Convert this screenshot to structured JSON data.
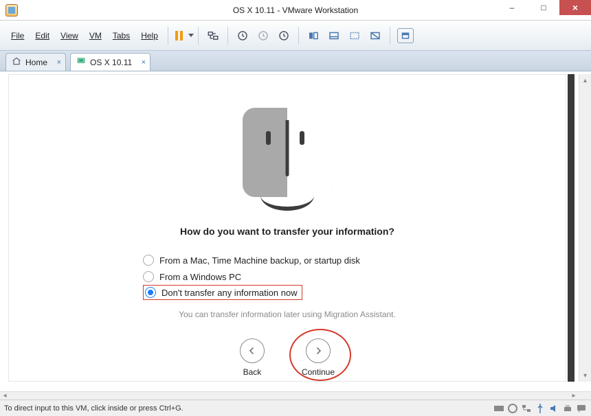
{
  "window": {
    "title": "OS X 10.11 - VMware Workstation",
    "min_label": "–",
    "max_label": "□",
    "close_label": "×"
  },
  "menus": {
    "file": "File",
    "edit": "Edit",
    "view": "View",
    "vm": "VM",
    "tabs": "Tabs",
    "help": "Help"
  },
  "tabs": {
    "home": "Home",
    "osx": "OS X 10.11"
  },
  "migration": {
    "prompt": "How do you want to transfer your information?",
    "option1": "From a Mac, Time Machine backup, or startup disk",
    "option2": "From a Windows PC",
    "option3": "Don't transfer any information now",
    "helper": "You can transfer information later using Migration Assistant.",
    "back_label": "Back",
    "continue_label": "Continue",
    "selected_index": 2
  },
  "status": {
    "hint": "To direct input to this VM, click inside or press Ctrl+G."
  },
  "icons": {
    "pause": "pause-icon",
    "snapshot": "snapshot-icon",
    "clock1": "clock-icon",
    "clock2": "clock-icon",
    "clock3": "clock-icon",
    "layout1": "layout-icon",
    "layout2": "layout-icon",
    "layout3": "layout-icon",
    "layout4": "layout-icon",
    "fullscreen": "fullscreen-icon"
  }
}
